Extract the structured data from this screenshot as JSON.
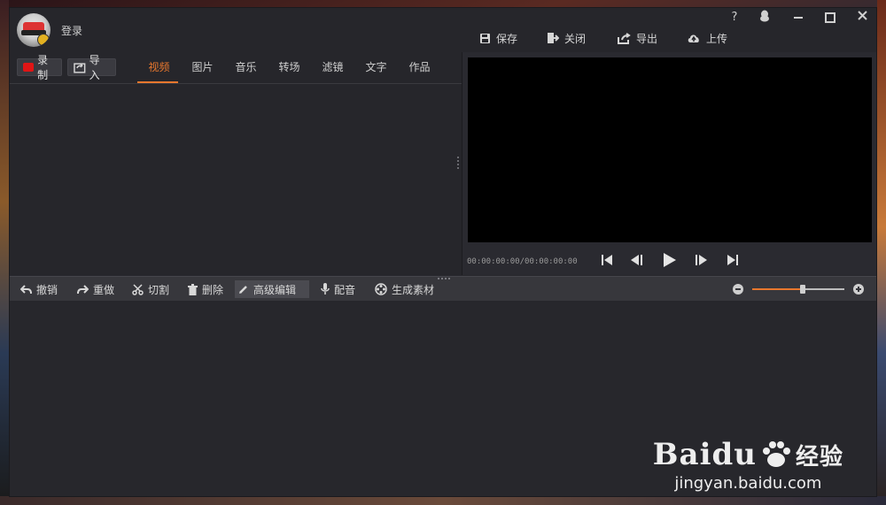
{
  "titlebar": {
    "login_label": "登录",
    "help_label": "?",
    "actions": [
      {
        "label": "保存",
        "icon": "save-icon"
      },
      {
        "label": "关闭",
        "icon": "exit-icon"
      },
      {
        "label": "导出",
        "icon": "export-icon"
      },
      {
        "label": "上传",
        "icon": "cloud-upload-icon"
      }
    ]
  },
  "media": {
    "record_label": "录制",
    "import_label": "导入",
    "tabs": [
      {
        "label": "视频",
        "active": true
      },
      {
        "label": "图片",
        "active": false
      },
      {
        "label": "音乐",
        "active": false
      },
      {
        "label": "转场",
        "active": false
      },
      {
        "label": "滤镜",
        "active": false
      },
      {
        "label": "文字",
        "active": false
      },
      {
        "label": "作品",
        "active": false
      }
    ]
  },
  "preview": {
    "timecode": "00:00:00:00/00:00:00:00"
  },
  "edit_toolbar": {
    "undo": "撤销",
    "redo": "重做",
    "cut": "切割",
    "delete": "删除",
    "advanced_edit": "高级编辑",
    "dub": "配音",
    "generate_material": "生成素材",
    "zoom_level": 0.55
  },
  "watermark": {
    "brand": "Baidu",
    "suffix": "经验",
    "url": "jingyan.baidu.com"
  },
  "colors": {
    "accent": "#e8772e",
    "record": "#e01515",
    "panel": "#27272c"
  }
}
